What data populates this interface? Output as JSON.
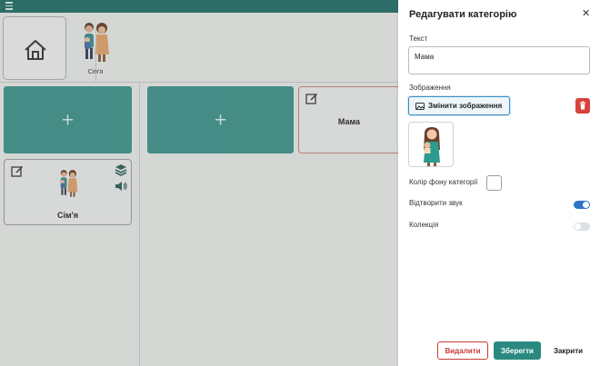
{
  "app": {
    "breadcrumb_family_label": "Сім'я",
    "add_symbol": "+",
    "cards": {
      "mama_title": "Мама",
      "family_title": "Сім'я"
    }
  },
  "panel": {
    "title": "Редагувати категорію",
    "close_symbol": "✕",
    "text_label": "Текст",
    "text_value": "Мама",
    "image_label": "Зображення",
    "change_image_label": "Змінити зображення",
    "bg_color_label": "Колір фону категорії",
    "bg_color": "#ffffff",
    "play_sound_label": "Відтворити звук",
    "play_sound_on": true,
    "collection_label": "Колекція",
    "collection_on": false,
    "delete_label": "Видалити",
    "save_label": "Зберегти",
    "close_label": "Закрити"
  },
  "colors": {
    "teal": "#2a8a82",
    "topbar": "#1f6d66",
    "danger": "#d8413c",
    "toggle_on": "#2f74c9"
  },
  "icons": [
    "menu-icon",
    "home-icon",
    "edit-icon",
    "layers-icon",
    "speaker-icon",
    "image-icon",
    "trash-icon",
    "close-icon"
  ]
}
